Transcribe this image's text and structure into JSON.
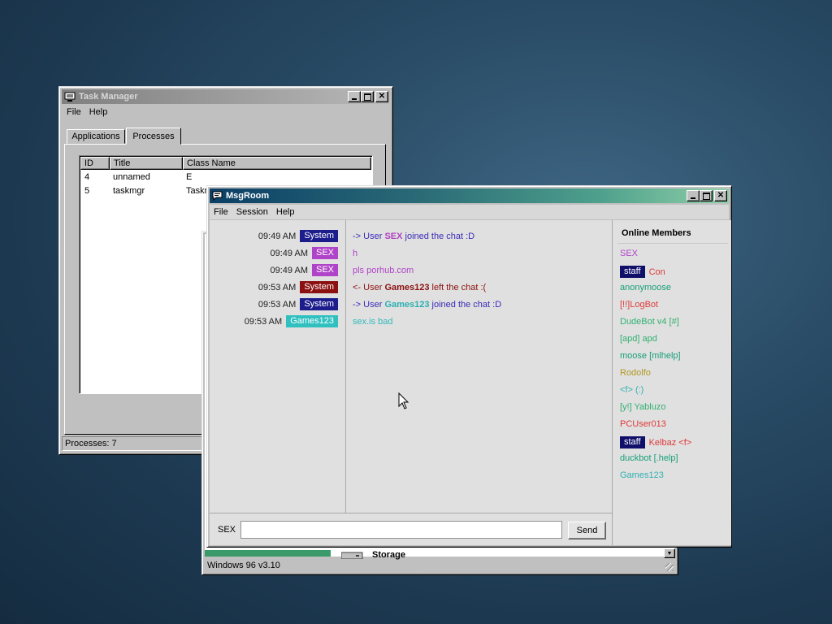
{
  "task_manager": {
    "title": "Task Manager",
    "menu": [
      "File",
      "Help"
    ],
    "tabs": [
      "Applications",
      "Processes"
    ],
    "columns": [
      "ID",
      "Title",
      "Class Name"
    ],
    "rows": [
      {
        "id": "4",
        "title": "unnamed",
        "class": "E"
      },
      {
        "id": "5",
        "title": "taskmgr",
        "class": "Taskm"
      }
    ],
    "status": "Processes: 7"
  },
  "back_window": {
    "storage_label": "Storage",
    "status": "Windows 96 v3.10"
  },
  "msgroom": {
    "title": "MsgRoom",
    "menu": [
      "File",
      "Session",
      "Help"
    ],
    "messages": [
      {
        "time": "09:49 AM",
        "user": "System",
        "user_color": "#1c1c8c",
        "parts": [
          {
            "t": "-> User ",
            "c": "#3a2bb8",
            "b": false
          },
          {
            "t": "SEX",
            "c": "#b040c0",
            "b": true
          },
          {
            "t": " joined the chat :D",
            "c": "#3a2bb8",
            "b": false
          }
        ]
      },
      {
        "time": "09:49 AM",
        "user": "SEX",
        "user_color": "#b044c8",
        "parts": [
          {
            "t": "h",
            "c": "#b044c8",
            "b": false
          }
        ]
      },
      {
        "time": "09:49 AM",
        "user": "SEX",
        "user_color": "#b044c8",
        "parts": [
          {
            "t": "pls porhub.com",
            "c": "#b044c8",
            "b": false
          }
        ]
      },
      {
        "time": "09:53 AM",
        "user": "System",
        "user_color": "#8c1010",
        "parts": [
          {
            "t": "<- User ",
            "c": "#8c1010",
            "b": false
          },
          {
            "t": "Games123",
            "c": "#8c1010",
            "b": true
          },
          {
            "t": " left the chat :(",
            "c": "#8c1010",
            "b": false
          }
        ]
      },
      {
        "time": "09:53 AM",
        "user": "System",
        "user_color": "#1c1c8c",
        "parts": [
          {
            "t": "-> User ",
            "c": "#3a2bb8",
            "b": false
          },
          {
            "t": "Games123",
            "c": "#2ab0b0",
            "b": true
          },
          {
            "t": " joined the chat :D",
            "c": "#3a2bb8",
            "b": false
          }
        ]
      },
      {
        "time": "09:53 AM",
        "user": "Games123",
        "user_color": "#30c0c0",
        "parts": [
          {
            "t": "sex.is bad",
            "c": "#30b8b8",
            "b": false
          }
        ]
      }
    ],
    "members_header": "Online Members",
    "members": [
      {
        "name": "SEX",
        "color": "#b044c8",
        "staff": false
      },
      {
        "name": "Con",
        "color": "#e03838",
        "staff": true
      },
      {
        "name": "anonymoose",
        "color": "#18a078",
        "staff": false
      },
      {
        "name": "[!!]LogBot",
        "color": "#e03838",
        "staff": false
      },
      {
        "name": "DudeBot v4 [#]",
        "color": "#30b070",
        "staff": false
      },
      {
        "name": "[apd] apd",
        "color": "#30b070",
        "staff": false
      },
      {
        "name": "moose [mlhelp]",
        "color": "#18a078",
        "staff": false
      },
      {
        "name": "Rodolfo",
        "color": "#b09820",
        "staff": false
      },
      {
        "name": "<f> (:)",
        "color": "#30b0b0",
        "staff": false
      },
      {
        "name": "[y!] Yabluzo",
        "color": "#30b070",
        "staff": false
      },
      {
        "name": "PCUser013",
        "color": "#e03838",
        "staff": false
      },
      {
        "name": "Kelbaz <f>",
        "color": "#e03838",
        "staff": true
      },
      {
        "name": "duckbot [.help]",
        "color": "#18a078",
        "staff": false
      },
      {
        "name": "Games123",
        "color": "#30b0b0",
        "staff": false
      }
    ],
    "staff_label": "staff",
    "username": "SEX",
    "input_value": "",
    "send_label": "Send"
  }
}
